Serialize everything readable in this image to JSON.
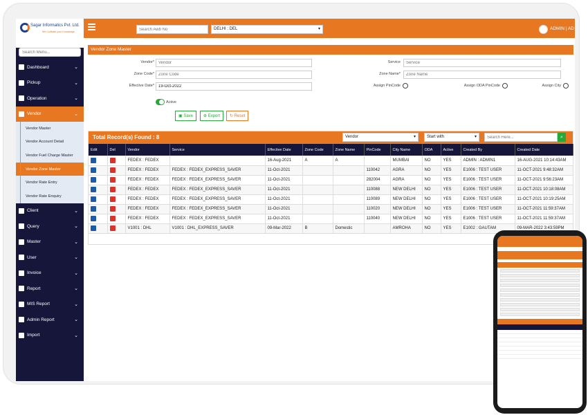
{
  "brand": {
    "name": "Sagar Informatics Pvt. Ltd.",
    "tagline": "We Cultivate your Knowledge"
  },
  "sidebar": {
    "search_placeholder": "Search Menu...",
    "items_top": [
      {
        "label": "Dashboard",
        "icon": "dashboard-icon"
      },
      {
        "label": "Pickup",
        "icon": "truck-icon"
      },
      {
        "label": "Operation",
        "icon": "cogs-icon"
      },
      {
        "label": "Vendor",
        "icon": "users-icon"
      }
    ],
    "vendor_sub": [
      "Vendor Master",
      "Vendor Account Detail",
      "Vendor Fuel Charge Master",
      "Vendor Zone Master",
      "Vendor Rate Entry",
      "Vendor Rate Enquiry"
    ],
    "items_bottom": [
      {
        "label": "Client",
        "icon": "client-icon"
      },
      {
        "label": "Query",
        "icon": "question-icon"
      },
      {
        "label": "Master",
        "icon": "folder-icon"
      },
      {
        "label": "User",
        "icon": "user-icon"
      },
      {
        "label": "Invoice",
        "icon": "invoice-icon"
      },
      {
        "label": "Report",
        "icon": "report-icon"
      },
      {
        "label": "MIS Report",
        "icon": "chart-icon"
      },
      {
        "label": "Admin Report",
        "icon": "admin-icon"
      },
      {
        "label": "Import",
        "icon": "import-icon"
      }
    ]
  },
  "topbar": {
    "search_placeholder": "Search Awb No",
    "branch": "DELHI : DEL",
    "user": "ADMIN | AD"
  },
  "form": {
    "title": "Vendor Zone Master",
    "vendor_label": "Vendor*",
    "vendor_placeholder": "Vendor",
    "zone_code_label": "Zone Code*",
    "zone_code_placeholder": "Zone Code",
    "effective_date_label": "Effective Date*",
    "effective_date_value": "19-Oct-2022",
    "service_label": "Service",
    "service_placeholder": "Service",
    "zone_name_label": "Zone Name*",
    "zone_name_placeholder": "Zone Name",
    "assign_pincode_label": "Assign PinCode",
    "assign_oda_label": "Assign ODA PinCode",
    "assign_city_label": "Assign City",
    "active_label": "Active",
    "save_label": "Save",
    "export_label": "Export",
    "reset_label": "Reset"
  },
  "records": {
    "title": "Total Record(s) Found : 8",
    "filter_field": "Vendor",
    "filter_mode": "Start with",
    "search_placeholder": "Search Here...",
    "columns": [
      "Edit",
      "Del",
      "Vendor",
      "Service",
      "Effective Date",
      "Zone Code",
      "Zone Name",
      "PinCode",
      "City Name",
      "ODA",
      "Active",
      "Created By",
      "Created Date"
    ],
    "rows": [
      [
        "FEDEX : FEDEX",
        "",
        "16-Aug-2021",
        "A",
        "A",
        "",
        "MUMBAI",
        "NO",
        "YES",
        "ADMIN : ADMIN1",
        "16-AUG-2021 10:14:43AM"
      ],
      [
        "FEDEX : FEDEX",
        "FEDEX : FEDEX_EXPRESS_SAVER",
        "11-Oct-2021",
        "",
        "",
        "110042",
        "AGRA",
        "NO",
        "YES",
        "E1006 : TEST USER",
        "11-OCT-2021 9:48:32AM"
      ],
      [
        "FEDEX : FEDEX",
        "FEDEX : FEDEX_EXPRESS_SAVER",
        "11-Oct-2021",
        "",
        "",
        "282004",
        "AGRA",
        "NO",
        "YES",
        "E1006 : TEST USER",
        "11-OCT-2021 9:56:23AM"
      ],
      [
        "FEDEX : FEDEX",
        "FEDEX : FEDEX_EXPRESS_SAVER",
        "11-Oct-2021",
        "",
        "",
        "110088",
        "NEW DELHI",
        "NO",
        "YES",
        "E1006 : TEST USER",
        "11-OCT-2021 10:18:08AM"
      ],
      [
        "FEDEX : FEDEX",
        "FEDEX : FEDEX_EXPRESS_SAVER",
        "11-Oct-2021",
        "",
        "",
        "110089",
        "NEW DELHI",
        "NO",
        "YES",
        "E1006 : TEST USER",
        "11-OCT-2021 10:19:25AM"
      ],
      [
        "FEDEX : FEDEX",
        "FEDEX : FEDEX_EXPRESS_SAVER",
        "11-Oct-2021",
        "",
        "",
        "110020",
        "NEW DELHI",
        "NO",
        "YES",
        "E1006 : TEST USER",
        "11-OCT-2021 11:59:37AM"
      ],
      [
        "FEDEX : FEDEX",
        "FEDEX : FEDEX_EXPRESS_SAVER",
        "11-Oct-2021",
        "",
        "",
        "110040",
        "NEW DELHI",
        "NO",
        "YES",
        "E1006 : TEST USER",
        "11-OCT-2021 11:59:37AM"
      ],
      [
        "V1001 : DHL",
        "V1001 : DHL_EXPRESS_SAVER",
        "09-Mar-2022",
        "B",
        "Domestic",
        "",
        "AMROHA",
        "NO",
        "YES",
        "E1002 : GAUTAM",
        "09-MAR-2022 3:43:59PM"
      ]
    ]
  },
  "colors": {
    "accent": "#e87722",
    "sidebar": "#15163a",
    "success": "#27a93a"
  }
}
